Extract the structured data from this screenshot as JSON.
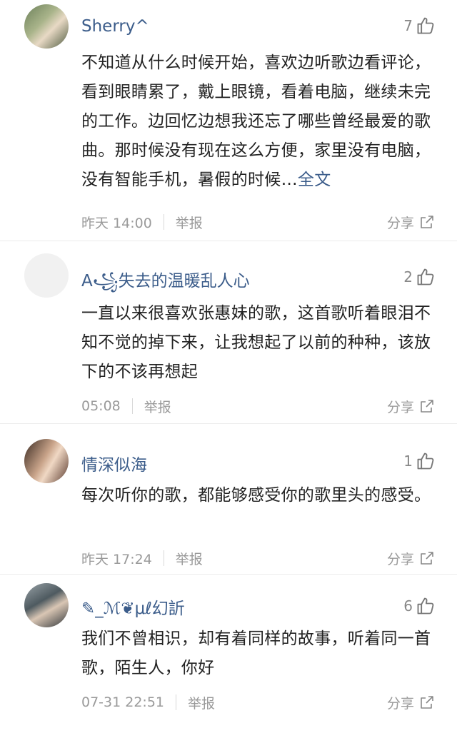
{
  "comments": [
    {
      "username": "Sherry^",
      "likes": "7",
      "text": "不知道从什么时候开始，喜欢边听歌边看评论，看到眼睛累了，戴上眼镜，看着电脑，继续未完的工作。边回忆边想我还忘了哪些曾经最爱的歌曲。那时候没有现在这么方便，家里没有电脑，没有智能手机，暑假的时候…",
      "more": "全文",
      "time": "昨天 14:00",
      "report": "举报",
      "share": "分享"
    },
    {
      "username": "A꧁失去的温暖乱人心",
      "likes": "2",
      "text": "一直以来很喜欢张惠妹的歌，这首歌听着眼泪不知不觉的掉下来，让我想起了以前的种种，该放下的不该再想起",
      "time": "05:08",
      "report": "举报",
      "share": "分享"
    },
    {
      "username": "情深似海",
      "likes": "1",
      "text": "每次听你的歌，都能够感受你的歌里头的感受。",
      "time": "昨天 17:24",
      "report": "举报",
      "share": "分享"
    },
    {
      "username": "✎_ℳ❦μℓ幻訢",
      "likes": "6",
      "text": "我们不曾相识，却有着同样的故事，听着同一首歌，陌生人，你好",
      "time": "07-31 22:51",
      "report": "举报",
      "share": "分享"
    }
  ],
  "icons": {
    "like": "thumbs-up-icon",
    "share": "share-icon"
  },
  "colors": {
    "username": "#3b5c8a",
    "meta": "#9a9a9a"
  }
}
